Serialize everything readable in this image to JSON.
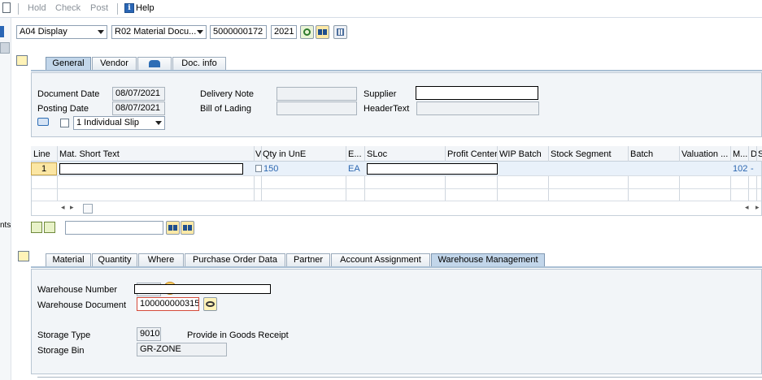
{
  "toolbar": {
    "hold": "Hold",
    "check": "Check",
    "post": "Post",
    "help": "Help"
  },
  "header": {
    "action": "A04 Display",
    "reference": "R02 Material Docu...",
    "doc_number": "5000000172",
    "year": "2021"
  },
  "general_tabs": [
    "General",
    "Vendor",
    "Doc. info"
  ],
  "general": {
    "document_date_label": "Document Date",
    "document_date": "08/07/2021",
    "posting_date_label": "Posting Date",
    "posting_date": "08/07/2021",
    "delivery_note_label": "Delivery Note",
    "bill_of_lading_label": "Bill of Lading",
    "supplier_label": "Supplier",
    "header_text_label": "HeaderText",
    "slip_option": "1 Individual Slip"
  },
  "items_table": {
    "columns": [
      "Line",
      "Mat. Short Text",
      "V",
      "Qty in UnE",
      "E...",
      "SLoc",
      "Profit Center",
      "WIP Batch",
      "Stock Segment",
      "Batch",
      "Valuation ...",
      "M...",
      "D",
      "S"
    ],
    "rows": [
      {
        "line": "1",
        "qty": "150",
        "unit": "EA",
        "movement": "102",
        "d": "-"
      }
    ]
  },
  "left_strip_text": "nts",
  "detail_tabs": [
    "Material",
    "Quantity",
    "Where",
    "Purchase Order Data",
    "Partner",
    "Account Assignment",
    "Warehouse Management"
  ],
  "warehouse": {
    "warehouse_number_label": "Warehouse Number",
    "warehouse_document_label": "Warehouse Document",
    "warehouse_document": "100000000315",
    "storage_type_label": "Storage Type",
    "storage_type": "9010",
    "storage_type_desc": "Provide in Goods Receipt",
    "storage_bin_label": "Storage Bin",
    "storage_bin": "GR-ZONE"
  }
}
